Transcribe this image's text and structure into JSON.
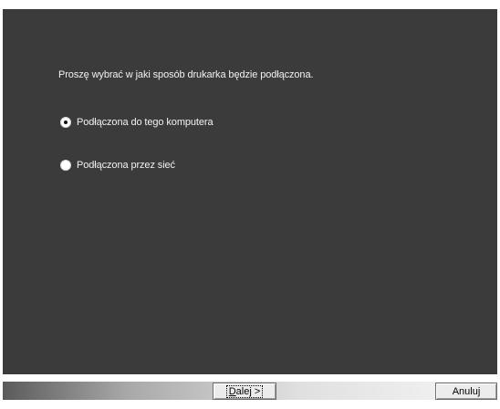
{
  "dialog": {
    "prompt": "Proszę wybrać w jaki sposób drukarka będzie podłączona.",
    "options": [
      {
        "label": "Podłączona do tego komputera",
        "selected": true
      },
      {
        "label": "Podłączona przez sieć",
        "selected": false
      }
    ]
  },
  "buttons": {
    "next_accel": "D",
    "next_rest": "alej >",
    "cancel": "Anuluj"
  },
  "colors": {
    "panel_background": "#3b3b3b",
    "text": "#f2f2f2"
  }
}
